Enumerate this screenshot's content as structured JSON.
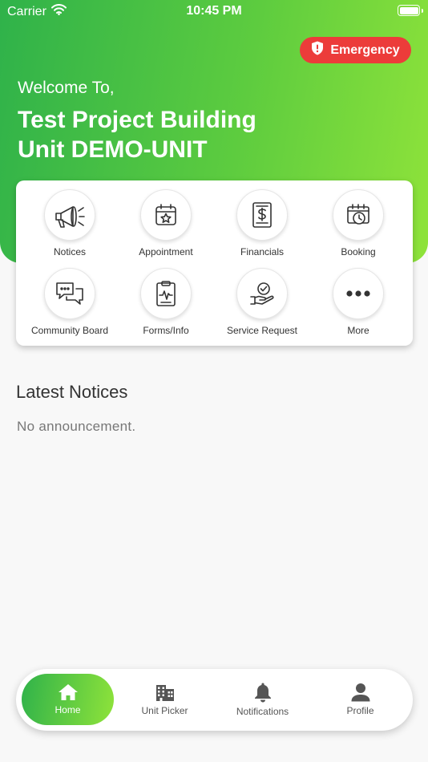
{
  "status_bar": {
    "carrier": "Carrier",
    "time": "10:45 PM"
  },
  "header": {
    "emergency_label": "Emergency",
    "welcome": "Welcome To,",
    "project_line": "Test Project Building",
    "unit_line": "Unit DEMO-UNIT"
  },
  "menu": {
    "items": [
      {
        "label": "Notices",
        "icon": "megaphone-icon"
      },
      {
        "label": "Appointment",
        "icon": "calendar-star-icon"
      },
      {
        "label": "Financials",
        "icon": "dollar-document-icon"
      },
      {
        "label": "Booking",
        "icon": "calendar-clock-icon"
      },
      {
        "label": "Community Board",
        "icon": "chat-bubbles-icon"
      },
      {
        "label": "Forms/Info",
        "icon": "clipboard-icon"
      },
      {
        "label": "Service Request",
        "icon": "hand-check-icon"
      },
      {
        "label": "More",
        "icon": "more-dots-icon"
      }
    ]
  },
  "notices": {
    "title": "Latest Notices",
    "empty_text": "No announcement."
  },
  "tabbar": {
    "active": "Home",
    "items": [
      {
        "label": "Home",
        "icon": "home-icon"
      },
      {
        "label": "Unit Picker",
        "icon": "building-icon"
      },
      {
        "label": "Notifications",
        "icon": "bell-icon"
      },
      {
        "label": "Profile",
        "icon": "person-icon"
      }
    ]
  },
  "colors": {
    "gradient_start": "#2fb24a",
    "gradient_end": "#8fe33a",
    "emergency": "#ec3c3a",
    "background": "#f8f8f8"
  }
}
